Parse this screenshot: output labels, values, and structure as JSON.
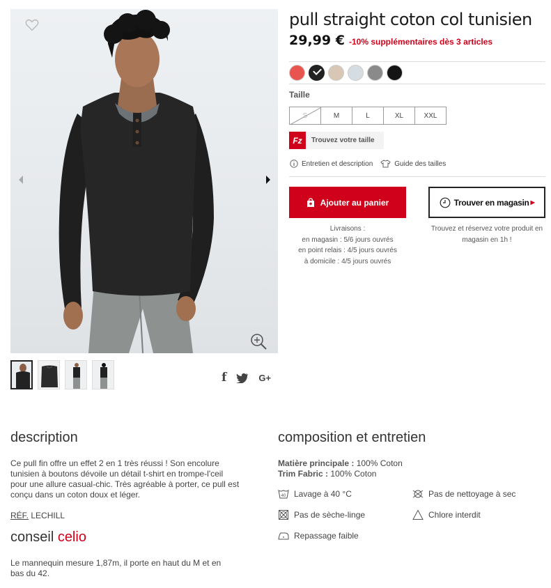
{
  "product": {
    "title": "pull straight coton col tunisien",
    "price": "29,99 €",
    "promo": "-10% supplémentaires dès 3 articles"
  },
  "colors": [
    {
      "name": "corail",
      "hex": "#e8554e"
    },
    {
      "name": "noir chiné",
      "hex": "#222222",
      "selected": true
    },
    {
      "name": "beige",
      "hex": "#d8c7b4"
    },
    {
      "name": "gris clair",
      "hex": "#d6dde2"
    },
    {
      "name": "gris chiné",
      "hex": "#8a8a8a"
    },
    {
      "name": "noir",
      "hex": "#141414"
    }
  ],
  "size_section": {
    "label": "Taille",
    "sizes": [
      {
        "label": "S",
        "available": false
      },
      {
        "label": "M",
        "available": true
      },
      {
        "label": "L",
        "available": true
      },
      {
        "label": "XL",
        "available": true
      },
      {
        "label": "XXL",
        "available": true
      }
    ]
  },
  "fit_finder": {
    "logo": "Fz",
    "label": "Trouvez votre taille"
  },
  "links": {
    "care": "Entretien et description",
    "size_guide": "Guide des tailles"
  },
  "buttons": {
    "add_to_cart": "Ajouter au panier",
    "find_in_store": "Trouver en magasin"
  },
  "delivery": {
    "title": "Livraisons :",
    "store": "en magasin : 5/6 jours ouvrés",
    "relay": "en point relais : 4/5 jours ouvrés",
    "home": "à domicile : 4/5 jours ouvrés"
  },
  "store_note": "Trouvez et réservez votre produit en magasin en 1h !",
  "social": {
    "facebook": "f",
    "twitter": "t",
    "google": "G+"
  },
  "description": {
    "heading": "description",
    "text": "Ce pull fin offre un effet 2 en 1 très réussi ! Son encolure tunisien à boutons dévoile un détail t-shirt en trompe-l'ceil pour une allure casual-chic. Très agréable à porter, ce pull est conçu dans un coton doux et léger.",
    "ref_label": "RÉF.",
    "ref_value": " LECHILL"
  },
  "advice": {
    "heading": "conseil ",
    "brand": "celio",
    "text": "Le mannequin mesure 1,87m, il porte en haut du M et en bas du 42."
  },
  "composition": {
    "heading": "composition et entretien",
    "main_label": "Matière principale :",
    "main_value": " 100% Coton",
    "trim_label": "Trim Fabric :",
    "trim_value": " 100% Coton",
    "care": {
      "wash": "Lavage à 40 °C",
      "no_dry_clean": "Pas de nettoyage à sec",
      "no_dryer": "Pas de sèche-linge",
      "no_chlorine": "Chlore interdit",
      "iron": "Repassage faible"
    },
    "wash_symbol": "40"
  }
}
